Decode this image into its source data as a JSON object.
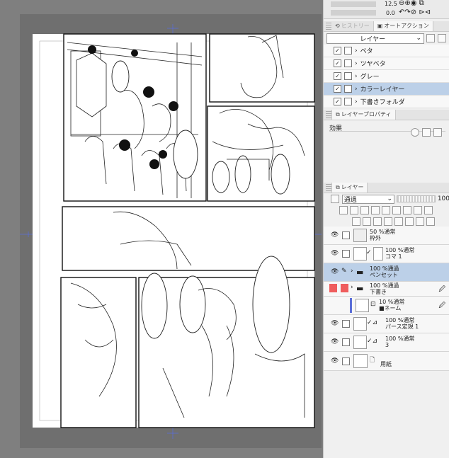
{
  "navigator": {
    "zoom_value": "12.5",
    "rotate_value": "0.0"
  },
  "auto_action_panel": {
    "tabs": [
      "ヒストリー",
      "オートアクション"
    ],
    "active_tab": "オートアクション",
    "set_selector": "レイヤー",
    "items": [
      {
        "label": "ベタ",
        "checked": true
      },
      {
        "label": "ツヤベタ",
        "checked": true
      },
      {
        "label": "グレー",
        "checked": true
      },
      {
        "label": "カラーレイヤー",
        "checked": true,
        "selected": true
      },
      {
        "label": "下書きフォルダ",
        "checked": true
      }
    ]
  },
  "layer_property_panel": {
    "tab": "レイヤープロパティ",
    "effect_label": "効果"
  },
  "layer_panel": {
    "tab": "レイヤー",
    "blend_mode": "通過",
    "opacity": "100",
    "layers": [
      {
        "line1": "50 %通常",
        "line2": "枠外"
      },
      {
        "line1": "100 %通常",
        "line2": "コマ 1"
      },
      {
        "line1": "100 %通過",
        "line2": "ペンセット",
        "folder": true,
        "selected": true
      },
      {
        "line1": "100 %通過",
        "line2": "下書き",
        "folder": true,
        "red": true
      },
      {
        "line1": "10 %通常",
        "line2": "■ネーム"
      },
      {
        "line1": "100 %通常",
        "line2": "パース定規 1"
      },
      {
        "line1": "100 %通常",
        "line2": "3"
      },
      {
        "line1": "",
        "line2": "用紙"
      }
    ]
  },
  "colors": {
    "selected_row": "#bcd0e8",
    "record_red": "#e53935",
    "draft_red": "#ef5d5d",
    "canvas_gray": "#7f7f7f"
  }
}
